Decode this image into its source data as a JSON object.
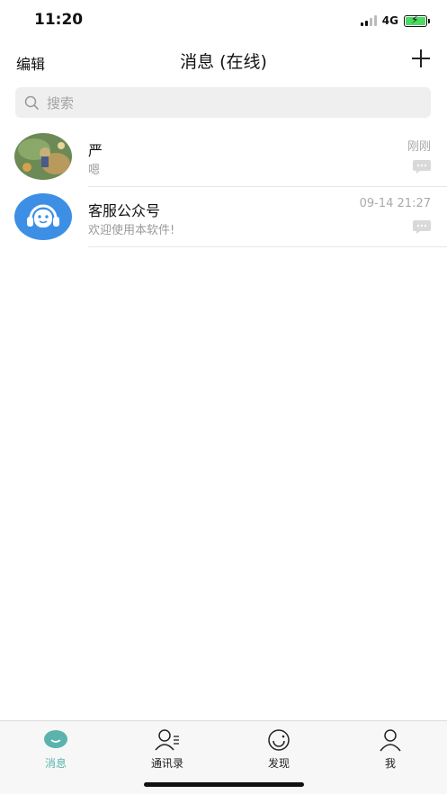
{
  "status": {
    "time": "11:20",
    "network": "4G"
  },
  "nav": {
    "edit_label": "编辑",
    "title": "消息 (在线)",
    "add_icon": "plus-icon"
  },
  "search": {
    "placeholder": "搜索",
    "icon": "search-icon"
  },
  "conversations": [
    {
      "name": "严",
      "last_message": "嗯",
      "time": "刚刚",
      "avatar": "game-scene-avatar"
    },
    {
      "name": "客服公众号",
      "last_message": "欢迎使用本软件!",
      "time": "09-14 21:27",
      "avatar": "customer-service-avatar"
    }
  ],
  "tabs": [
    {
      "label": "消息",
      "icon": "chat-bubble-icon",
      "active": true
    },
    {
      "label": "通讯录",
      "icon": "contacts-icon",
      "active": false
    },
    {
      "label": "发现",
      "icon": "discover-icon",
      "active": false
    },
    {
      "label": "我",
      "icon": "profile-icon",
      "active": false
    }
  ],
  "colors": {
    "accent": "#5ab3ad",
    "service_avatar": "#3d8fe6",
    "search_bg": "#efefef"
  }
}
